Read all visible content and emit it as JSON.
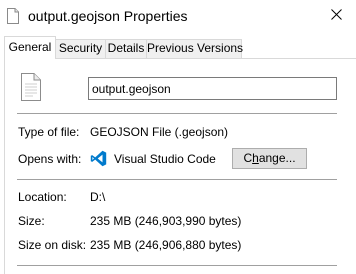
{
  "window": {
    "title": "output.geojson Properties",
    "close_glyph": "✕"
  },
  "tabs": [
    {
      "label": "General",
      "active": true
    },
    {
      "label": "Security",
      "active": false
    },
    {
      "label": "Details",
      "active": false
    },
    {
      "label": "Previous Versions",
      "active": false
    }
  ],
  "general": {
    "file_name": "output.geojson",
    "type_label": "Type of file:",
    "type_value": "GEOJSON File (.geojson)",
    "opens_label": "Opens with:",
    "opens_value": "Visual Studio Code",
    "change_prefix": "C",
    "change_accel": "h",
    "change_suffix": "ange...",
    "location_label": "Location:",
    "location_value": "D:\\",
    "size_label": "Size:",
    "size_value": "235 MB (246,903,990 bytes)",
    "size_disk_label": "Size on disk:",
    "size_disk_value": "235 MB (246,906,880 bytes)"
  },
  "icons": {
    "title": "file-icon",
    "file": "file-icon",
    "app": "vscode-icon",
    "close": "close-icon"
  },
  "colors": {
    "vscode_blue": "#007acc",
    "tab_border": "#d9d9d9",
    "button_face": "#e1e1e1"
  }
}
